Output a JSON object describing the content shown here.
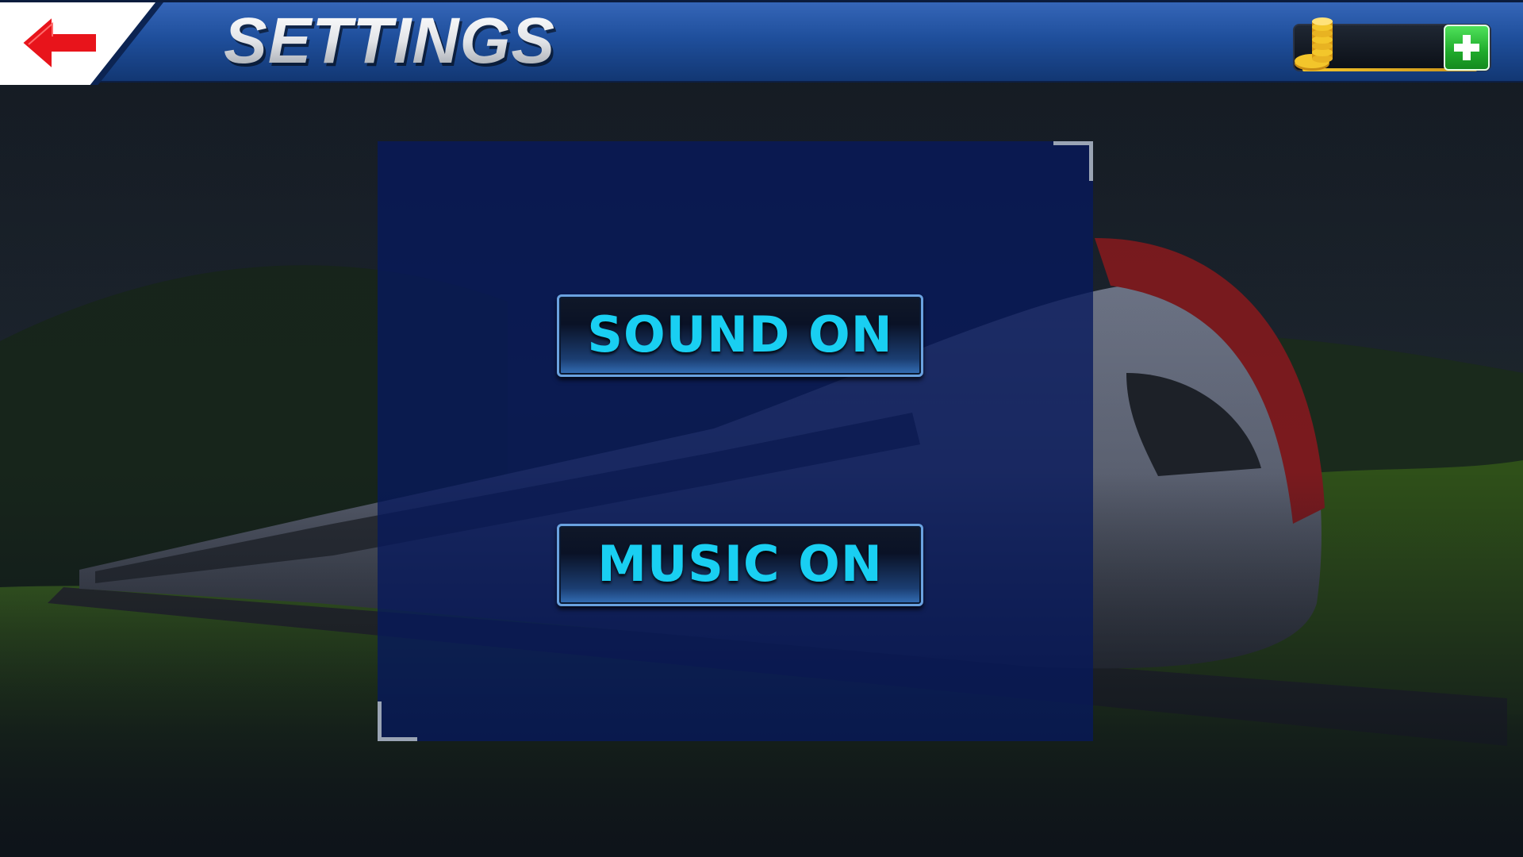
{
  "header": {
    "title": "SETTINGS",
    "back_icon": "left-arrow-icon",
    "coins": {
      "value": "",
      "coin_icon": "coin-stack-icon",
      "add_icon": "plus-icon"
    }
  },
  "settings": {
    "sound_label": "SOUND ON",
    "music_label": "MUSIC ON"
  },
  "colors": {
    "header_blue": "#1f4f9c",
    "panel_navy": "#07185c",
    "button_text_cyan": "#19cff2",
    "back_arrow_red": "#e8141b",
    "add_green": "#1faa2b",
    "coin_gold": "#f3c62b"
  }
}
